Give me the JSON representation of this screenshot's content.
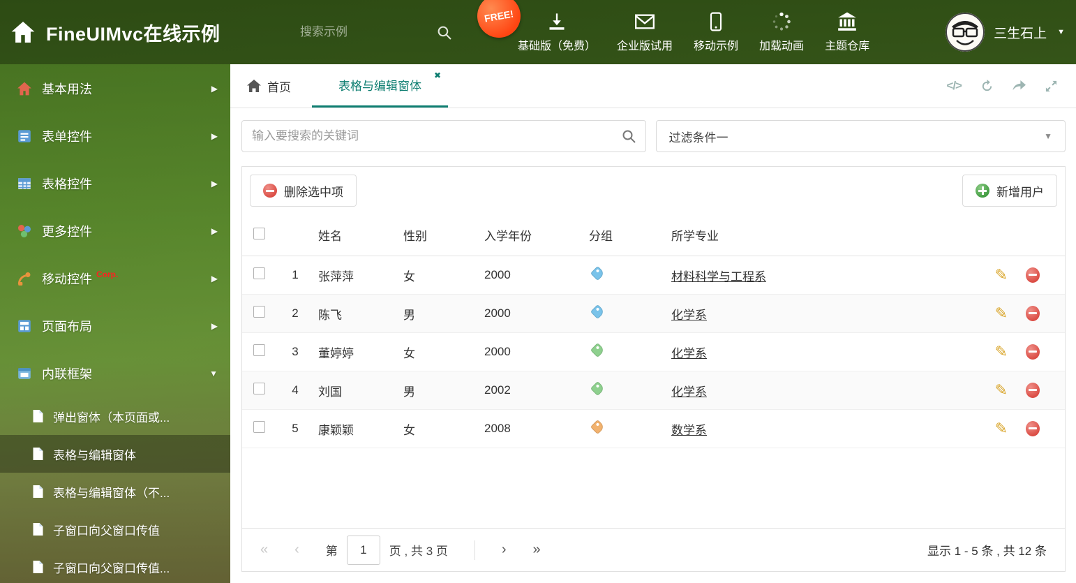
{
  "header": {
    "title": "FineUIMvc在线示例",
    "search_placeholder": "搜索示例",
    "free_badge": "FREE!",
    "nav": [
      {
        "label": "基础版（免费）"
      },
      {
        "label": "企业版试用"
      },
      {
        "label": "移动示例"
      },
      {
        "label": "加载动画"
      },
      {
        "label": "主题仓库"
      }
    ],
    "user_name": "三生石上"
  },
  "sidebar": {
    "items": [
      {
        "label": "基本用法"
      },
      {
        "label": "表单控件"
      },
      {
        "label": "表格控件"
      },
      {
        "label": "更多控件"
      },
      {
        "label": "移动控件",
        "badge": "Corp."
      },
      {
        "label": "页面布局"
      },
      {
        "label": "内联框架"
      }
    ],
    "subitems": [
      {
        "label": "弹出窗体（本页面或..."
      },
      {
        "label": "表格与编辑窗体"
      },
      {
        "label": "表格与编辑窗体（不..."
      },
      {
        "label": "子窗口向父窗口传值"
      },
      {
        "label": "子窗口向父窗口传值..."
      }
    ]
  },
  "tabs": {
    "home": "首页",
    "active": "表格与编辑窗体"
  },
  "main": {
    "search_placeholder": "输入要搜索的关键词",
    "filter_value": "过滤条件一",
    "toolbar": {
      "delete_label": "删除选中项",
      "add_label": "新增用户"
    },
    "table": {
      "columns": {
        "name": "姓名",
        "gender": "性别",
        "year": "入学年份",
        "group": "分组",
        "major": "所学专业"
      },
      "rows": [
        {
          "num": "1",
          "name": "张萍萍",
          "gender": "女",
          "year": "2000",
          "tag_color": "#79c3ea",
          "major": "材料科学与工程系"
        },
        {
          "num": "2",
          "name": "陈飞",
          "gender": "男",
          "year": "2000",
          "tag_color": "#79c3ea",
          "major": "化学系"
        },
        {
          "num": "3",
          "name": "董婷婷",
          "gender": "女",
          "year": "2000",
          "tag_color": "#8ed08e",
          "major": "化学系"
        },
        {
          "num": "4",
          "name": "刘国",
          "gender": "男",
          "year": "2002",
          "tag_color": "#8ed08e",
          "major": "化学系"
        },
        {
          "num": "5",
          "name": "康颖颖",
          "gender": "女",
          "year": "2008",
          "tag_color": "#f2b26e",
          "major": "数学系"
        }
      ]
    },
    "pagination": {
      "label_page": "第",
      "current_page": "1",
      "label_total": "页 , 共 3 页",
      "summary": "显示 1 - 5 条 , 共 12 条"
    }
  },
  "colors": {
    "accent": "#0e7e71"
  }
}
